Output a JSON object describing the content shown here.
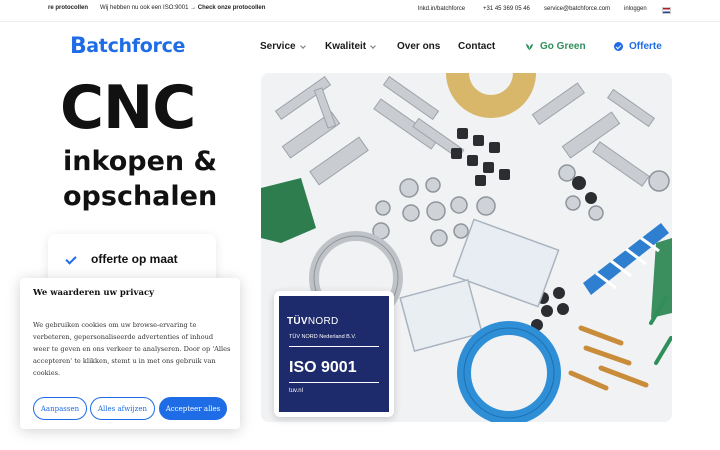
{
  "topbar": {
    "ticker_bold_1": "re protocollen",
    "ticker_text": "Wij hebben nu ook een ISO:9001 →",
    "ticker_bold_2": "Check onze protocollen",
    "linkedin": "lnkd.in/batchforce",
    "phone": "+31 45 369 05 46",
    "email": "service@batchforce.com",
    "login": "inloggen",
    "language_flag": "nl-flag-icon"
  },
  "nav": {
    "logo_initial": "B",
    "logo_rest": "atchforce",
    "items": [
      {
        "label": "Service",
        "dropdown": true
      },
      {
        "label": "Kwaliteit",
        "dropdown": true
      },
      {
        "label": "Over ons",
        "dropdown": false
      },
      {
        "label": "Contact",
        "dropdown": false
      }
    ],
    "go_green": "Go Green",
    "offerte": "Offerte"
  },
  "hero": {
    "title": "CNC",
    "subtitle_line1": "inkopen &",
    "subtitle_line2": "opschalen",
    "feature": "offerte op maat"
  },
  "badge": {
    "brand_bold": "TÜV",
    "brand_rest": "NORD",
    "company": "TÜV NORD Nederland B.V.",
    "standard": "ISO 9001",
    "site": "tuv.nl"
  },
  "cookie": {
    "title": "We waarderen uw privacy",
    "body": "We gebruiken cookies om uw browse-ervaring te verbeteren, gepersonaliseerde advertenties of inhoud weer te geven en ons verkeer te analyseren. Door op 'Alles accepteren' te klikken, stemt u in met ons gebruik van cookies.",
    "customize": "Aanpassen",
    "reject": "Alles afwijzen",
    "accept": "Accepteer alles"
  },
  "colors": {
    "brand_blue": "#1f6de6",
    "green": "#2f8f5b",
    "badge_navy": "#1d2a6b"
  }
}
